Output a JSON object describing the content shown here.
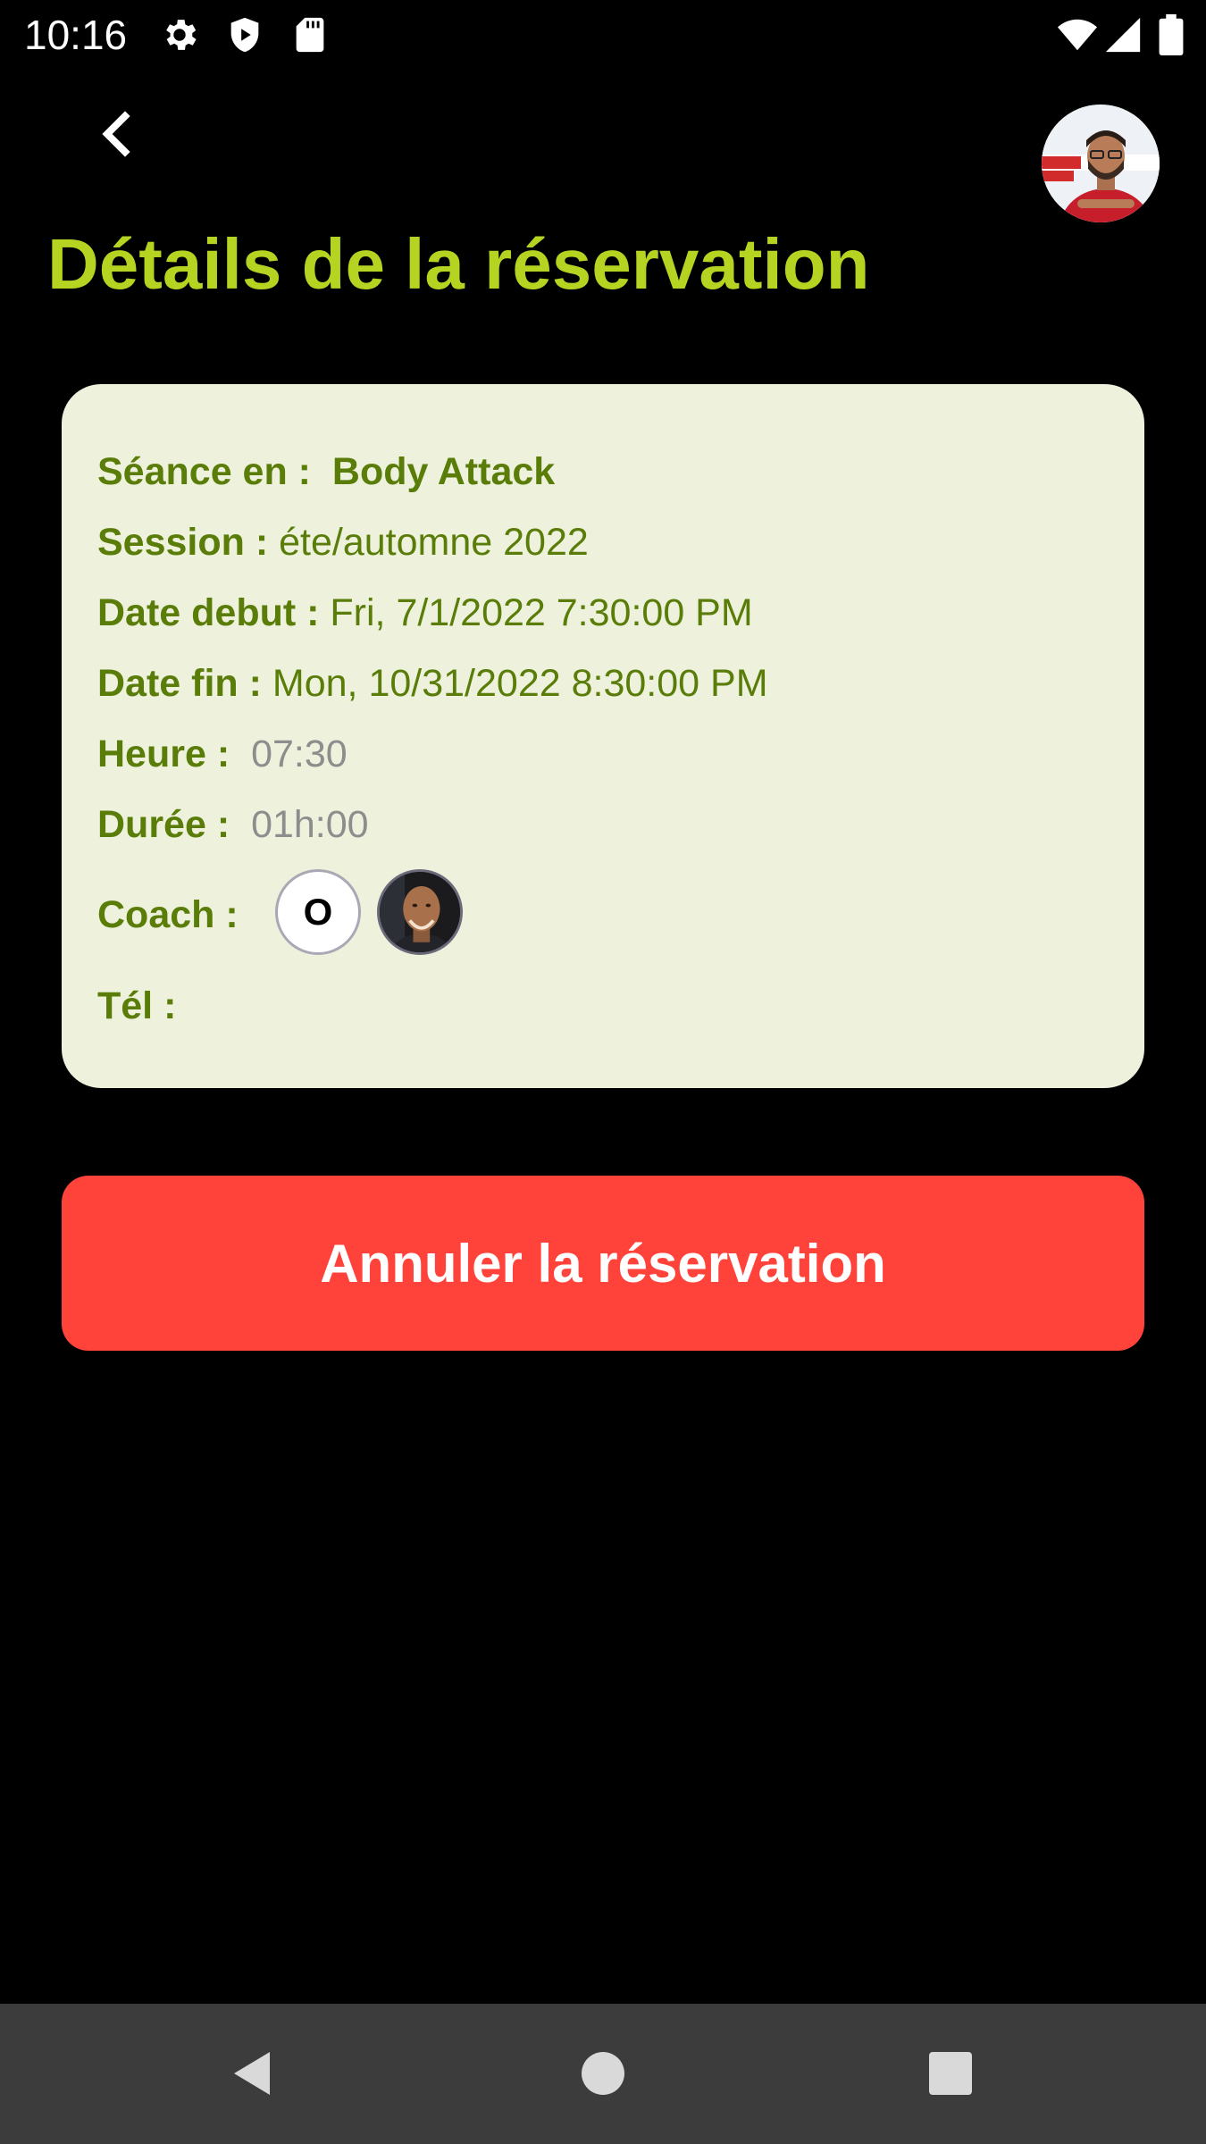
{
  "status_bar": {
    "time": "10:16",
    "icons": [
      "gear-icon",
      "shield-icon",
      "sd-card-icon",
      "wifi-icon",
      "signal-icon",
      "battery-icon"
    ]
  },
  "header": {
    "back_icon": "chevron-left-icon",
    "title": "Détails de la réservation"
  },
  "details": {
    "seance_label": "Séance en :",
    "seance_value": "Body Attack",
    "session_label": "Session :",
    "session_value": "éte/automne 2022",
    "date_debut_label": "Date debut :",
    "date_debut_value": "Fri, 7/1/2022 7:30:00 PM",
    "date_fin_label": "Date fin :",
    "date_fin_value": "Mon, 10/31/2022 8:30:00 PM",
    "heure_label": "Heure :",
    "heure_value": "07:30",
    "duree_label": "Durée :",
    "duree_value": "01h:00",
    "coach_label": "Coach :",
    "coach_initial": "O",
    "tel_label": "Tél :"
  },
  "actions": {
    "cancel_label": "Annuler la réservation"
  },
  "navigation": {
    "buttons": [
      "back-triangle-icon",
      "home-circle-icon",
      "recents-square-icon"
    ]
  },
  "colors": {
    "background": "#000000",
    "title": "#b5d321",
    "card_background": "#eef2dc",
    "label_green": "#5a7d0a",
    "value_gray": "#8d8d8d",
    "cancel_button": "#ff433a",
    "nav_bar": "#3c3c3c"
  }
}
